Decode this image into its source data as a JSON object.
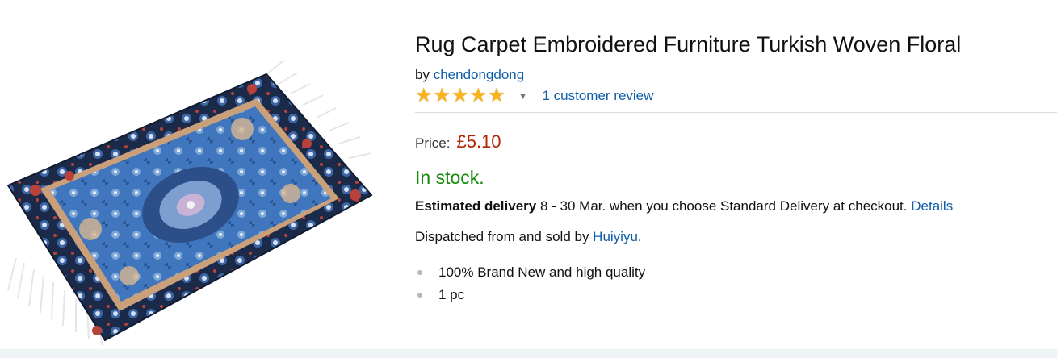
{
  "product": {
    "title": "Rug Carpet Embroidered Furniture Turkish Woven Floral",
    "by_prefix": "by",
    "brand": "chendongdong",
    "rating": {
      "stars": 5,
      "max": 5,
      "reviews_label": "1 customer review"
    },
    "price_label": "Price:",
    "price": "£5.10",
    "availability": "In stock.",
    "delivery_bold": "Estimated delivery",
    "delivery_text": " 8 - 30 Mar. when you choose Standard Delivery at checkout. ",
    "delivery_link": "Details",
    "dispatch_prefix": "Dispatched from and sold by ",
    "seller": "Huiyiyu",
    "dispatch_suffix": ".",
    "bullets": [
      "100% Brand New and high quality",
      "1 pc"
    ]
  },
  "colors": {
    "price": "#b12704",
    "stock": "#138a07",
    "link": "#0f5ea8",
    "star": "#f8b41c"
  },
  "icons": {
    "star": "star-icon",
    "caret": "caret-down-icon"
  }
}
